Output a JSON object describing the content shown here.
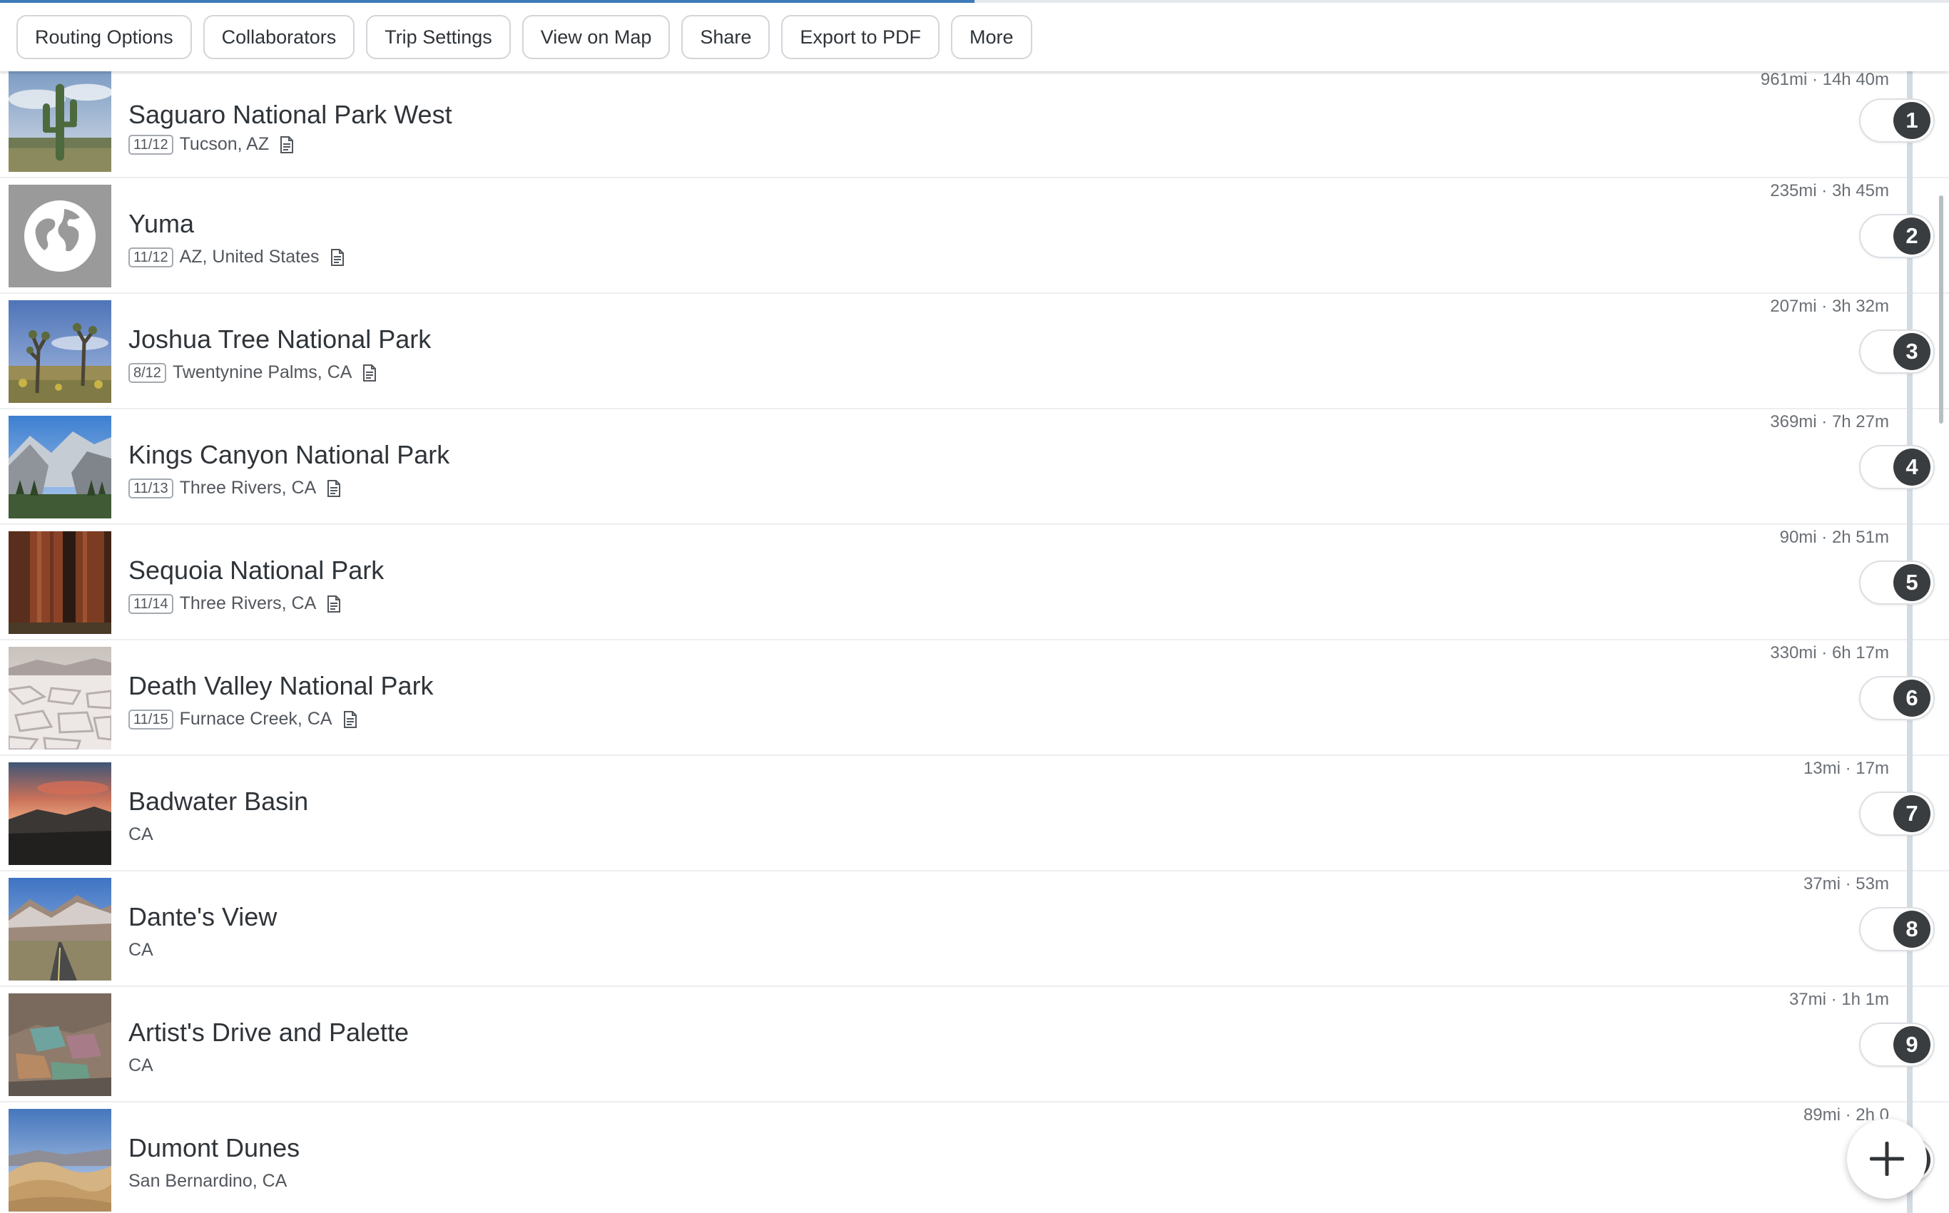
{
  "progress": {
    "fraction": 0.5
  },
  "toolbar": {
    "buttons": [
      "Routing Options",
      "Collaborators",
      "Trip Settings",
      "View on Map",
      "Share",
      "Export to PDF",
      "More"
    ]
  },
  "stops": [
    {
      "number": "1",
      "name": "Saguaro National Park West",
      "date": "11/12",
      "location": "Tucson, AZ",
      "distance": "961mi · 14h 40m",
      "has_note": true,
      "thumb": "cactus"
    },
    {
      "number": "2",
      "name": "Yuma",
      "date": "11/12",
      "location": "AZ, United States",
      "distance": "235mi · 3h 45m",
      "has_note": true,
      "thumb": "globe"
    },
    {
      "number": "3",
      "name": "Joshua Tree National Park",
      "date": "8/12",
      "location": "Twentynine Palms, CA",
      "distance": "207mi · 3h 32m",
      "has_note": true,
      "thumb": "joshua"
    },
    {
      "number": "4",
      "name": "Kings Canyon National Park",
      "date": "11/13",
      "location": "Three Rivers, CA",
      "distance": "369mi · 7h 27m",
      "has_note": true,
      "thumb": "canyon"
    },
    {
      "number": "5",
      "name": "Sequoia National Park",
      "date": "11/14",
      "location": "Three Rivers, CA",
      "distance": "90mi · 2h 51m",
      "has_note": true,
      "thumb": "sequoia"
    },
    {
      "number": "6",
      "name": "Death Valley National Park",
      "date": "11/15",
      "location": "Furnace Creek, CA",
      "distance": "330mi · 6h 17m",
      "has_note": true,
      "thumb": "saltflat"
    },
    {
      "number": "7",
      "name": "Badwater Basin",
      "date": "",
      "location": "CA",
      "distance": "13mi · 17m",
      "has_note": false,
      "thumb": "sunset"
    },
    {
      "number": "8",
      "name": "Dante's View",
      "date": "",
      "location": "CA",
      "distance": "37mi · 53m",
      "has_note": false,
      "thumb": "road"
    },
    {
      "number": "9",
      "name": "Artist's Drive and Palette",
      "date": "",
      "location": "CA",
      "distance": "37mi · 1h 1m",
      "has_note": false,
      "thumb": "palette"
    },
    {
      "number": "10",
      "name": "Dumont Dunes",
      "date": "",
      "location": "San Bernardino, CA",
      "distance": "89mi · 2h 0",
      "has_note": false,
      "thumb": "dunes"
    }
  ],
  "icons": {
    "note": "note-icon",
    "add": "plus-icon",
    "placeholder": "globe-icon"
  },
  "colors": {
    "progress": "#3d7ab8",
    "order_badge": "#3a3d40",
    "route_line": "#d3dbe3"
  }
}
